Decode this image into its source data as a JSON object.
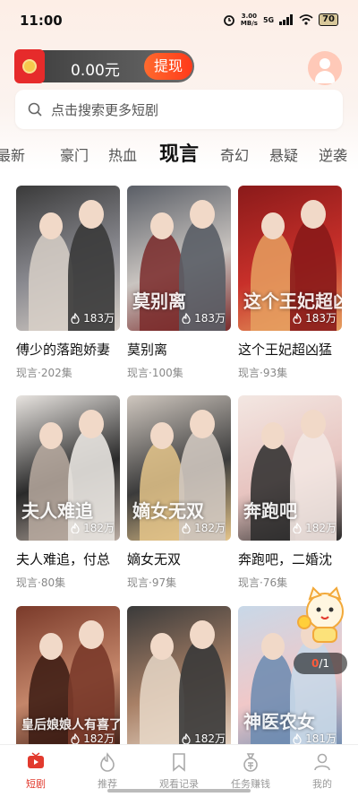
{
  "status": {
    "time": "11:00",
    "net_speed": "3.00",
    "net_unit": "MB/s",
    "network": "5G",
    "battery": "70"
  },
  "wallet": {
    "amount": "0.00元",
    "withdraw_label": "提现"
  },
  "search": {
    "placeholder": "点击搜索更多短剧"
  },
  "tabs": [
    {
      "label": "最新"
    },
    {
      "label": "豪门"
    },
    {
      "label": "热血"
    },
    {
      "label": "现言",
      "active": true
    },
    {
      "label": "奇幻"
    },
    {
      "label": "悬疑"
    },
    {
      "label": "逆袭"
    }
  ],
  "dramas": [
    {
      "title": "傅少的落跑娇妻",
      "genre": "现言",
      "episodes": "202集",
      "views": "183万",
      "art": "",
      "colors": [
        "#3a3a3a",
        "#8a8a90",
        "#d8d0c8"
      ]
    },
    {
      "title": "莫别离",
      "genre": "现言",
      "episodes": "100集",
      "views": "183万",
      "art": "莫别离",
      "colors": [
        "#5a5e66",
        "#c9c4c0",
        "#7a2a2a"
      ]
    },
    {
      "title": "这个王妃超凶猛",
      "genre": "现言",
      "episodes": "93集",
      "views": "183万",
      "art": "这个王妃超凶猛",
      "colors": [
        "#8a1a1a",
        "#c8302a",
        "#e6a060"
      ]
    },
    {
      "title": "夫人难追，付总",
      "genre": "现言",
      "episodes": "80集",
      "views": "182万",
      "art": "夫人难追",
      "colors": [
        "#e8e4e0",
        "#2a2a2a",
        "#b8aaa0"
      ]
    },
    {
      "title": "嫡女无双",
      "genre": "现言",
      "episodes": "97集",
      "views": "182万",
      "art": "嫡女无双",
      "colors": [
        "#cfc7bf",
        "#3b3b3b",
        "#e4c48a"
      ]
    },
    {
      "title": "奔跑吧，二婚沈",
      "genre": "现言",
      "episodes": "76集",
      "views": "182万",
      "art": "奔跑吧",
      "colors": [
        "#f3e7e2",
        "#e7c4c0",
        "#2a2a2a"
      ]
    },
    {
      "title": "",
      "genre": "",
      "episodes": "",
      "views": "182万",
      "art": "皇后娘娘人有喜了",
      "colors": [
        "#7a3a2a",
        "#c4866a",
        "#3a1a12"
      ]
    },
    {
      "title": "",
      "genre": "",
      "episodes": "",
      "views": "182万",
      "art": "",
      "colors": [
        "#3a3a3a",
        "#a88066",
        "#e8d8c8"
      ]
    },
    {
      "title": "",
      "genre": "",
      "episodes": "",
      "views": "181万",
      "art": "神医农女",
      "colors": [
        "#c8d8e8",
        "#f0c8c8",
        "#6a8ab0"
      ]
    }
  ],
  "floating": {
    "counter_current": "0",
    "counter_total": "/1"
  },
  "bottom_nav": [
    {
      "label": "短剧",
      "icon": "tv-icon",
      "active": true
    },
    {
      "label": "推荐",
      "icon": "flame-icon"
    },
    {
      "label": "观看记录",
      "icon": "bookmark-icon"
    },
    {
      "label": "任务赚钱",
      "icon": "money-bag-icon"
    },
    {
      "label": "我的",
      "icon": "person-icon"
    }
  ],
  "colors": {
    "accent": "#e23a2e",
    "withdraw": "#ff4a22"
  }
}
